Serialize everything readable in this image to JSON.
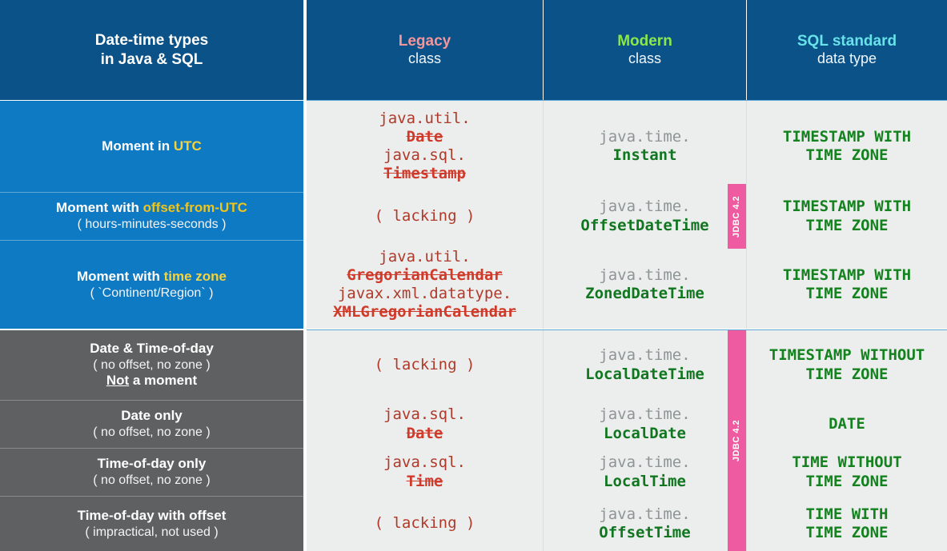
{
  "header": {
    "col1_line1": "Date-time types",
    "col1_line2": "in Java & SQL",
    "col2_word": "Legacy",
    "col2_sub": "class",
    "col3_word": "Modern",
    "col3_sub": "class",
    "col4_word": "SQL standard",
    "col4_sub": "data type"
  },
  "colors": {
    "header_bg": "#0b5289",
    "label_blue": "#0e7ac4",
    "label_gray": "#5f6062",
    "data_bg": "#eceded",
    "legacy_red": "#cf3a2a",
    "legacy_pkg": "#b03a2a",
    "modern_green": "#10761f",
    "sql_green": "#14821f",
    "pkg_gray": "#8d9596",
    "badge_pink": "#ef5ba1",
    "highlight_yellow": "#f5d33c",
    "highlight_gold": "#f0c419",
    "legacy_title": "#f4959b",
    "modern_title": "#8ce84a",
    "sql_title": "#67e2e8"
  },
  "badges": {
    "upper": "JDBC 4.2",
    "lower": "JDBC 4.2"
  },
  "rows": [
    {
      "label_main_pre": "Moment in ",
      "label_main_hl": "UTC",
      "label_sub": "",
      "label_extra": "",
      "legacy": [
        {
          "pkg": "java.util.",
          "cls": "Date",
          "struck": true
        },
        {
          "pkg": "java.sql.",
          "cls": "Timestamp",
          "struck": true
        }
      ],
      "modern": [
        {
          "pkg": "java.time.",
          "cls": "Instant"
        }
      ],
      "sql": [
        "TIMESTAMP WITH",
        "TIME ZONE"
      ]
    },
    {
      "label_main_pre": "Moment with ",
      "label_main_hl": "offset-from-UTC",
      "label_sub": "( hours-minutes-seconds )",
      "label_extra": "",
      "legacy": [
        {
          "lacking": "( lacking )"
        }
      ],
      "modern": [
        {
          "pkg": "java.time.",
          "cls": "OffsetDateTime"
        }
      ],
      "sql": [
        "TIMESTAMP WITH",
        "TIME ZONE"
      ]
    },
    {
      "label_main_pre": "Moment with ",
      "label_main_hl": "time zone",
      "label_sub": "( `Continent/Region` )",
      "label_extra": "",
      "legacy": [
        {
          "pkg": "java.util.",
          "cls": "GregorianCalendar",
          "struck": true
        },
        {
          "pkg": "javax.xml.datatype.",
          "cls": "XMLGregorianCalendar",
          "struck": true
        }
      ],
      "modern": [
        {
          "pkg": "java.time.",
          "cls": "ZonedDateTime"
        }
      ],
      "sql": [
        "TIMESTAMP WITH",
        "TIME ZONE"
      ]
    },
    {
      "label_main_pre": "Date & Time-of-day",
      "label_main_hl": "",
      "label_sub": "( no offset, no zone )",
      "label_extra_u": "Not",
      "label_extra": " a moment",
      "legacy": [
        {
          "lacking": "( lacking )"
        }
      ],
      "modern": [
        {
          "pkg": "java.time.",
          "cls": "LocalDateTime"
        }
      ],
      "sql": [
        "TIMESTAMP WITHOUT",
        "TIME ZONE"
      ]
    },
    {
      "label_main_pre": "Date only",
      "label_main_hl": "",
      "label_sub": "( no offset, no zone )",
      "label_extra": "",
      "legacy": [
        {
          "pkg": "java.sql.",
          "cls": "Date",
          "struck": true
        }
      ],
      "modern": [
        {
          "pkg": "java.time.",
          "cls": "LocalDate"
        }
      ],
      "sql": [
        "DATE"
      ]
    },
    {
      "label_main_pre": "Time-of-day only",
      "label_main_hl": "",
      "label_sub": "( no offset, no zone )",
      "label_extra": "",
      "legacy": [
        {
          "pkg": "java.sql.",
          "cls": "Time",
          "struck": true
        }
      ],
      "modern": [
        {
          "pkg": "java.time.",
          "cls": "LocalTime"
        }
      ],
      "sql": [
        "TIME WITHOUT",
        "TIME ZONE"
      ]
    },
    {
      "label_main_pre": "Time-of-day with offset",
      "label_main_hl": "",
      "label_sub": "( impractical, not used )",
      "label_extra": "",
      "legacy": [
        {
          "lacking": "( lacking )"
        }
      ],
      "modern": [
        {
          "pkg": "java.time.",
          "cls": "OffsetTime"
        }
      ],
      "sql": [
        "TIME WITH",
        "TIME ZONE"
      ]
    }
  ]
}
